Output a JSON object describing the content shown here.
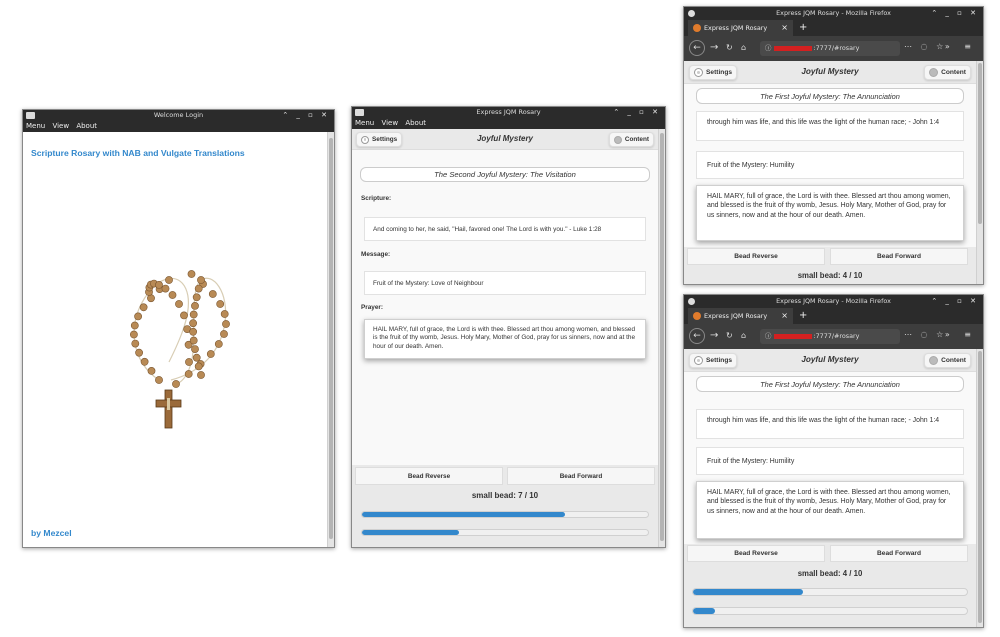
{
  "window1": {
    "title": "Welcome Login",
    "menu": [
      "Menu",
      "View",
      "About"
    ],
    "heading": "Scripture Rosary with NAB and Vulgate Translations",
    "byline": "by Mezcel"
  },
  "window2": {
    "title": "Express JQM Rosary",
    "menu": [
      "Menu",
      "View",
      "About"
    ],
    "settings_label": "Settings",
    "header_title": "Joyful Mystery",
    "content_label": "Content",
    "mystery_title": "The Second Joyful Mystery: The Visitation",
    "scripture_label": "Scripture:",
    "scripture_text": "And coming to her, he said, \"Hail, favored one! The Lord is with you.\" - Luke 1:28",
    "message_label": "Message:",
    "message_text": "Fruit of the Mystery: Love of Neighbour",
    "prayer_label": "Prayer:",
    "prayer_text": "HAIL MARY, full of grace, the Lord is with thee. Blessed art thou among women, and blessed is the fruit of thy womb, Jesus. Holy Mary, Mother of God, pray for us sinners, now and at the hour of our death. Amen.",
    "bead_reverse": "Bead Reverse",
    "bead_forward": "Bead Forward",
    "counter": "small bead: 7 / 10",
    "progress": [
      0.71,
      0.34
    ]
  },
  "window3": {
    "title": "Express JQM Rosary - Mozilla Firefox",
    "tab_label": "Express JQM Rosary",
    "url_tail": ":7777/#rosary",
    "settings_label": "Settings",
    "header_title": "Joyful Mystery",
    "content_label": "Content",
    "mystery_title": "The First Joyful Mystery: The Annunciation",
    "scripture_text": "through him was life, and this life was the light of the human race; - John 1:4",
    "message_text": "Fruit of the Mystery: Humility",
    "prayer_text": "HAIL MARY, full of grace, the Lord is with thee. Blessed art thou among women, and blessed is the fruit of thy womb, Jesus. Holy Mary, Mother of God, pray for us sinners, now and at the hour of our death. Amen.",
    "bead_reverse": "Bead Reverse",
    "bead_forward": "Bead Forward",
    "counter": "small bead: 4 / 10"
  },
  "window4": {
    "title": "Express JQM Rosary - Mozilla Firefox",
    "tab_label": "Express JQM Rosary",
    "url_tail": ":7777/#rosary",
    "settings_label": "Settings",
    "header_title": "Joyful Mystery",
    "content_label": "Content",
    "mystery_title": "The First Joyful Mystery: The Annunciation",
    "scripture_text": "through him was life, and this life was the light of the human race; - John 1:4",
    "message_text": "Fruit of the Mystery: Humility",
    "prayer_text": "HAIL MARY, full of grace, the Lord is with thee. Blessed art thou among women, and blessed is the fruit of thy womb, Jesus. Holy Mary, Mother of God, pray for us sinners, now and at the hour of our death. Amen.",
    "bead_reverse": "Bead Reverse",
    "bead_forward": "Bead Forward",
    "counter": "small bead: 4 / 10",
    "progress": [
      0.4,
      0.08
    ]
  },
  "colors": {
    "accent": "#3388cc",
    "titlebar": "#2b2b2b",
    "redaction": "#d32020"
  }
}
